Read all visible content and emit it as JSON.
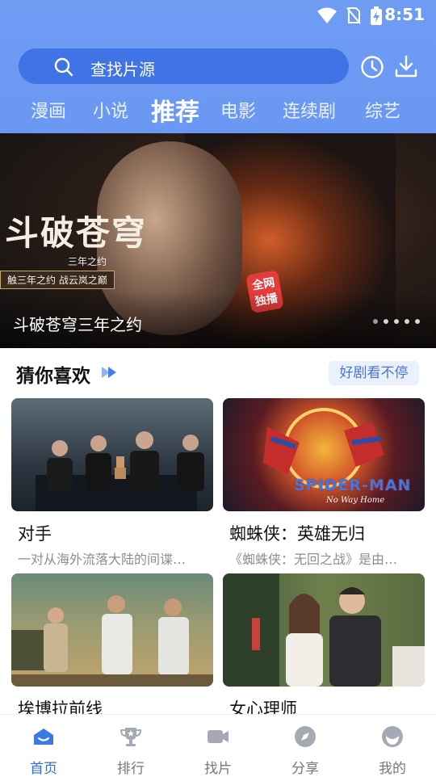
{
  "status_bar": {
    "time": "8:51"
  },
  "search": {
    "placeholder": "查找片源"
  },
  "tabs": [
    {
      "label": "漫画"
    },
    {
      "label": "小说"
    },
    {
      "label": "推荐",
      "active": true
    },
    {
      "label": "电影"
    },
    {
      "label": "连续剧"
    },
    {
      "label": "综艺"
    }
  ],
  "banner": {
    "title": "斗破苍穹三年之约",
    "logo_title": "斗破苍穹",
    "logo_subtitle": "三年之约",
    "logo_tagline": "触三年之约 战云岚之巅",
    "badge_line1": "全网",
    "badge_line2": "独播",
    "page_count": 5,
    "active_page": 0
  },
  "section": {
    "title": "猜你喜欢",
    "more_button": "好剧看不停"
  },
  "cards": [
    {
      "title": "对手",
      "desc": "一对从海外流落大陆的间谍…"
    },
    {
      "title": "蜘蛛侠：英雄无归",
      "desc": "《蜘蛛侠：无回之战》是由…",
      "poster_title": "SPIDER-MAN",
      "poster_subtitle": "No Way Home"
    },
    {
      "title": "埃博拉前线",
      "desc": ""
    },
    {
      "title": "女心理师",
      "desc": ""
    }
  ],
  "bottom_nav": [
    {
      "label": "首页",
      "icon": "home-icon",
      "active": true
    },
    {
      "label": "排行",
      "icon": "trophy-icon"
    },
    {
      "label": "找片",
      "icon": "video-camera-icon"
    },
    {
      "label": "分享",
      "icon": "compass-icon"
    },
    {
      "label": "我的",
      "icon": "profile-icon"
    }
  ],
  "colors": {
    "header_blue": "#6f9cf3",
    "search_blue": "#3f73e6",
    "accent": "#2f6bd9"
  }
}
